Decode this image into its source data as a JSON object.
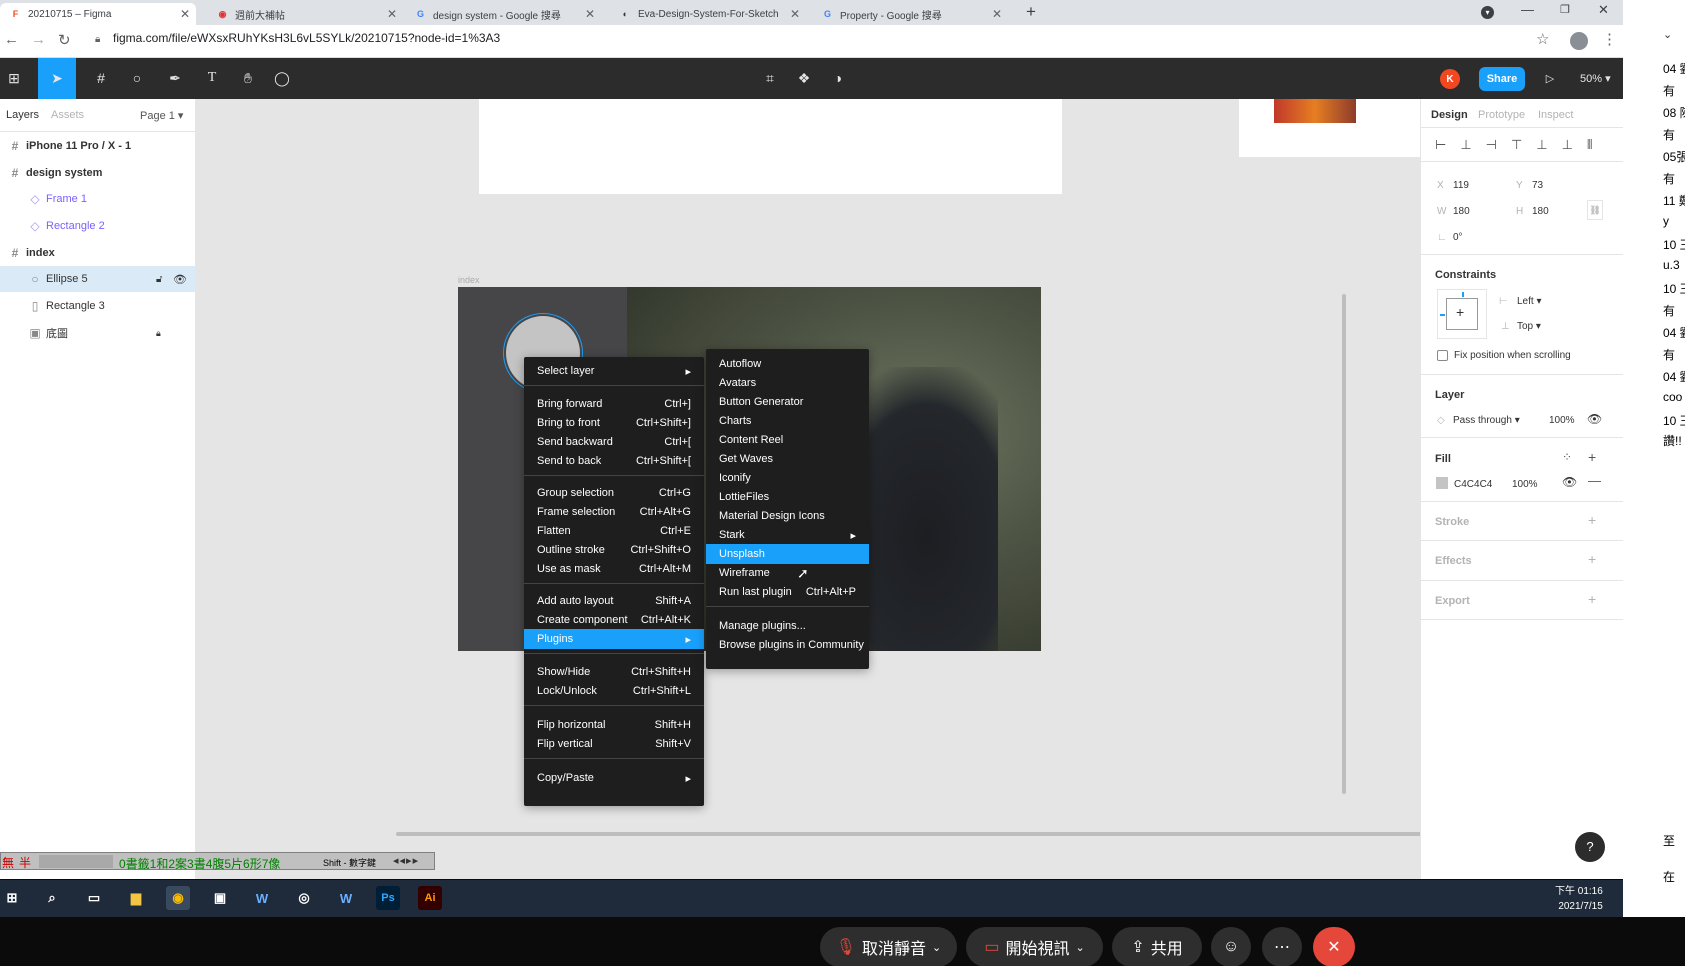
{
  "browser": {
    "tabs": [
      {
        "title": "20210715 – Figma",
        "active": true
      },
      {
        "title": "週前大補帖",
        "active": false
      },
      {
        "title": "design system - Google 搜尋",
        "active": false
      },
      {
        "title": "Eva-Design-System-For-Sketch",
        "active": false
      },
      {
        "title": "Property - Google 搜尋",
        "active": false
      }
    ],
    "url": "figma.com/file/eWXsxRUhYKsH3L6vL5SYLk/20210715?node-id=1%3A3"
  },
  "toolbar": {
    "avatar_initial": "K",
    "share_label": "Share",
    "zoom": "50%"
  },
  "left_panel": {
    "tabs": [
      "Layers",
      "Assets"
    ],
    "page": "Page 1",
    "layers": [
      {
        "name": "iPhone 11 Pro / X - 1",
        "icon": "#"
      },
      {
        "name": "design system",
        "icon": "#"
      },
      {
        "name": "Frame 1",
        "icon": "◇"
      },
      {
        "name": "Rectangle 2",
        "icon": "◇"
      },
      {
        "name": "index",
        "icon": "#"
      },
      {
        "name": "Ellipse 5",
        "icon": "○"
      },
      {
        "name": "Rectangle 3",
        "icon": "▯"
      },
      {
        "name": "底圖",
        "icon": "▣"
      }
    ]
  },
  "canvas": {
    "frame_label": "index"
  },
  "context_menu": {
    "items": [
      {
        "label": "Select layer",
        "shortcut": "▸"
      },
      {
        "label": "Bring forward",
        "shortcut": "Ctrl+]"
      },
      {
        "label": "Bring to front",
        "shortcut": "Ctrl+Shift+]"
      },
      {
        "label": "Send backward",
        "shortcut": "Ctrl+["
      },
      {
        "label": "Send to back",
        "shortcut": "Ctrl+Shift+["
      },
      {
        "label": "Group selection",
        "shortcut": "Ctrl+G"
      },
      {
        "label": "Frame selection",
        "shortcut": "Ctrl+Alt+G"
      },
      {
        "label": "Flatten",
        "shortcut": "Ctrl+E"
      },
      {
        "label": "Outline stroke",
        "shortcut": "Ctrl+Shift+O"
      },
      {
        "label": "Use as mask",
        "shortcut": "Ctrl+Alt+M"
      },
      {
        "label": "Add auto layout",
        "shortcut": "Shift+A"
      },
      {
        "label": "Create component",
        "shortcut": "Ctrl+Alt+K"
      },
      {
        "label": "Plugins",
        "shortcut": "▸"
      },
      {
        "label": "Show/Hide",
        "shortcut": "Ctrl+Shift+H"
      },
      {
        "label": "Lock/Unlock",
        "shortcut": "Ctrl+Shift+L"
      },
      {
        "label": "Flip horizontal",
        "shortcut": "Shift+H"
      },
      {
        "label": "Flip vertical",
        "shortcut": "Shift+V"
      },
      {
        "label": "Copy/Paste",
        "shortcut": "▸"
      }
    ]
  },
  "plugins_menu": {
    "items": [
      {
        "label": "Autoflow",
        "shortcut": ""
      },
      {
        "label": "Avatars",
        "shortcut": ""
      },
      {
        "label": "Button Generator",
        "shortcut": ""
      },
      {
        "label": "Charts",
        "shortcut": ""
      },
      {
        "label": "Content Reel",
        "shortcut": ""
      },
      {
        "label": "Get Waves",
        "shortcut": ""
      },
      {
        "label": "Iconify",
        "shortcut": ""
      },
      {
        "label": "LottieFiles",
        "shortcut": ""
      },
      {
        "label": "Material Design Icons",
        "shortcut": ""
      },
      {
        "label": "Stark",
        "shortcut": "▸"
      },
      {
        "label": "Unsplash",
        "shortcut": ""
      },
      {
        "label": "Wireframe",
        "shortcut": ""
      },
      {
        "label": "Run last plugin",
        "shortcut": "Ctrl+Alt+P"
      },
      {
        "label": "Manage plugins...",
        "shortcut": ""
      },
      {
        "label": "Browse plugins in Community",
        "shortcut": ""
      }
    ]
  },
  "right_panel": {
    "tabs": [
      "Design",
      "Prototype",
      "Inspect"
    ],
    "x_label": "X",
    "x": "119",
    "y_label": "Y",
    "y": "73",
    "w_label": "W",
    "w": "180",
    "h_label": "H",
    "h": "180",
    "rotation": "0°",
    "constraints_title": "Constraints",
    "constraint_h": "Left",
    "constraint_v": "Top",
    "fix_position": "Fix position when scrolling",
    "layer_title": "Layer",
    "blend": "Pass through",
    "layer_opacity": "100%",
    "fill_title": "Fill",
    "fill_hex": "C4C4C4",
    "fill_opacity": "100%",
    "stroke_title": "Stroke",
    "effects_title": "Effects",
    "export_title": "Export",
    "help": "?"
  },
  "ime": {
    "mode1": "無",
    "mode2": "半",
    "status": "0書籤1和2案3書4腹5片6形7像",
    "shift_hint": "Shift - 數字鍵"
  },
  "taskbar": {
    "time": "下午 01:16",
    "date": "2021/7/15"
  },
  "meeting": {
    "unmute": "取消靜音",
    "video": "開始視訊",
    "share": "共用"
  },
  "side_strip": [
    "04 劉",
    "有",
    "08 陳",
    "有",
    "05張",
    "有",
    "11 鄭",
    "y",
    "10 王",
    "u.3",
    "10 王",
    "有",
    "04 劉",
    "有",
    "04 劉",
    "coo",
    "10 王",
    "讚!!",
    "至",
    "在"
  ],
  "colors": {
    "accent": "#18a0fb",
    "fill": "#C4C4C4",
    "toolbar": "#2c2c2c"
  }
}
